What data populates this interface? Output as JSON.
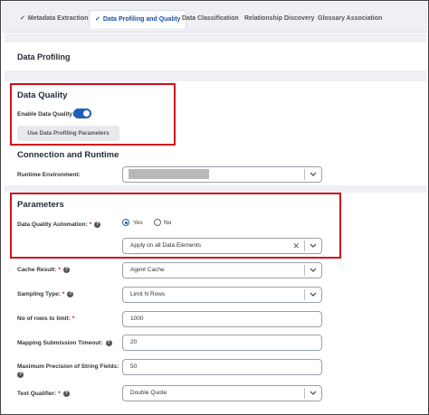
{
  "tabs": [
    {
      "label": "Metadata Extraction",
      "checked": true,
      "active": false
    },
    {
      "label": "Data Profiling and Quality",
      "checked": true,
      "active": true
    },
    {
      "label": "Data Classification",
      "checked": false,
      "active": false
    },
    {
      "label": "Relationship Discovery",
      "checked": false,
      "active": false
    },
    {
      "label": "Glossary Association",
      "checked": false,
      "active": false
    }
  ],
  "page": {
    "title": "Data Profiling"
  },
  "data_quality": {
    "title": "Data Quality",
    "enable_label": "Enable Data Quality:",
    "enable_on": true,
    "params_button": "Use Data Profiling Parameters"
  },
  "connection": {
    "title": "Connection and Runtime",
    "runtime_label": "Runtime Environment:",
    "runtime_value": ""
  },
  "parameters": {
    "title": "Parameters",
    "dq_automation_label": "Data Quality Automation:",
    "yes_label": "Yes",
    "no_label": "No",
    "automation_value": "Apply on all Data Elements"
  },
  "fields": {
    "cache_result_label": "Cache Result:",
    "cache_result_value": "Agent Cache",
    "sampling_type_label": "Sampling Type:",
    "sampling_type_value": "Limit N Rows",
    "rows_limit_label": "No of rows to limit:",
    "rows_limit_value": "1000",
    "mapping_timeout_label": "Mapping Submission Timeout:",
    "mapping_timeout_value": "20",
    "max_precision_label": "Maximum Precision of String Fields:",
    "max_precision_value": "50",
    "text_qualifier_label": "Text Qualifier:",
    "text_qualifier_value": "Double Quote"
  },
  "symbols": {
    "check": "✓",
    "asterisk": "*",
    "help": "?",
    "clear": "✕"
  },
  "colors": {
    "accent": "#1e5fb8",
    "highlight": "#d0101c",
    "required": "#c8102e"
  }
}
